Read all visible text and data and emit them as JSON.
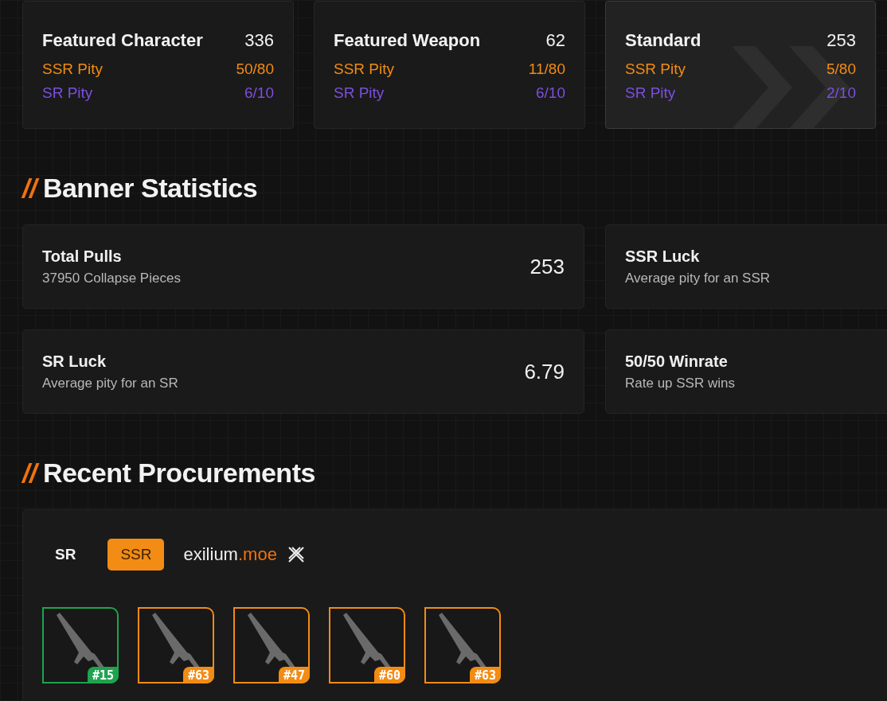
{
  "banners": [
    {
      "title": "Featured Character",
      "count": "336",
      "selected": false,
      "rows": [
        {
          "kind": "ssr",
          "label": "SSR Pity",
          "value": "50/80"
        },
        {
          "kind": "sr",
          "label": "SR Pity",
          "value": "6/10"
        }
      ]
    },
    {
      "title": "Featured Weapon",
      "count": "62",
      "selected": false,
      "rows": [
        {
          "kind": "ssr",
          "label": "SSR Pity",
          "value": "11/80"
        },
        {
          "kind": "sr",
          "label": "SR Pity",
          "value": "6/10"
        }
      ]
    },
    {
      "title": "Standard",
      "count": "253",
      "selected": true,
      "rows": [
        {
          "kind": "ssr",
          "label": "SSR Pity",
          "value": "5/80"
        },
        {
          "kind": "sr",
          "label": "SR Pity",
          "value": "2/10"
        }
      ]
    }
  ],
  "statistics": {
    "heading_mark": "//",
    "heading": "Banner Statistics",
    "cards": [
      {
        "title": "Total Pulls",
        "subtitle": "37950 Collapse Pieces",
        "value": "253"
      },
      {
        "title": "SSR Luck",
        "subtitle": "Average pity for an SSR"
      },
      {
        "title": "SR Luck",
        "subtitle": "Average pity for an SR",
        "value": "6.79"
      },
      {
        "title": "50/50 Winrate",
        "subtitle": "Rate up SSR wins"
      }
    ]
  },
  "procurements": {
    "heading_mark": "//",
    "heading": "Recent Procurements",
    "tabs": [
      {
        "label": "SR",
        "selected": false
      },
      {
        "label": "SSR",
        "selected": true
      }
    ],
    "brand": {
      "name": "exilium",
      "suffix": ".moe"
    },
    "items": [
      {
        "pity": "#15",
        "color": "#1fa34f"
      },
      {
        "pity": "#63",
        "color": "#f28c14"
      },
      {
        "pity": "#47",
        "color": "#f28c14"
      },
      {
        "pity": "#60",
        "color": "#f28c14"
      },
      {
        "pity": "#63",
        "color": "#f28c14"
      }
    ]
  }
}
